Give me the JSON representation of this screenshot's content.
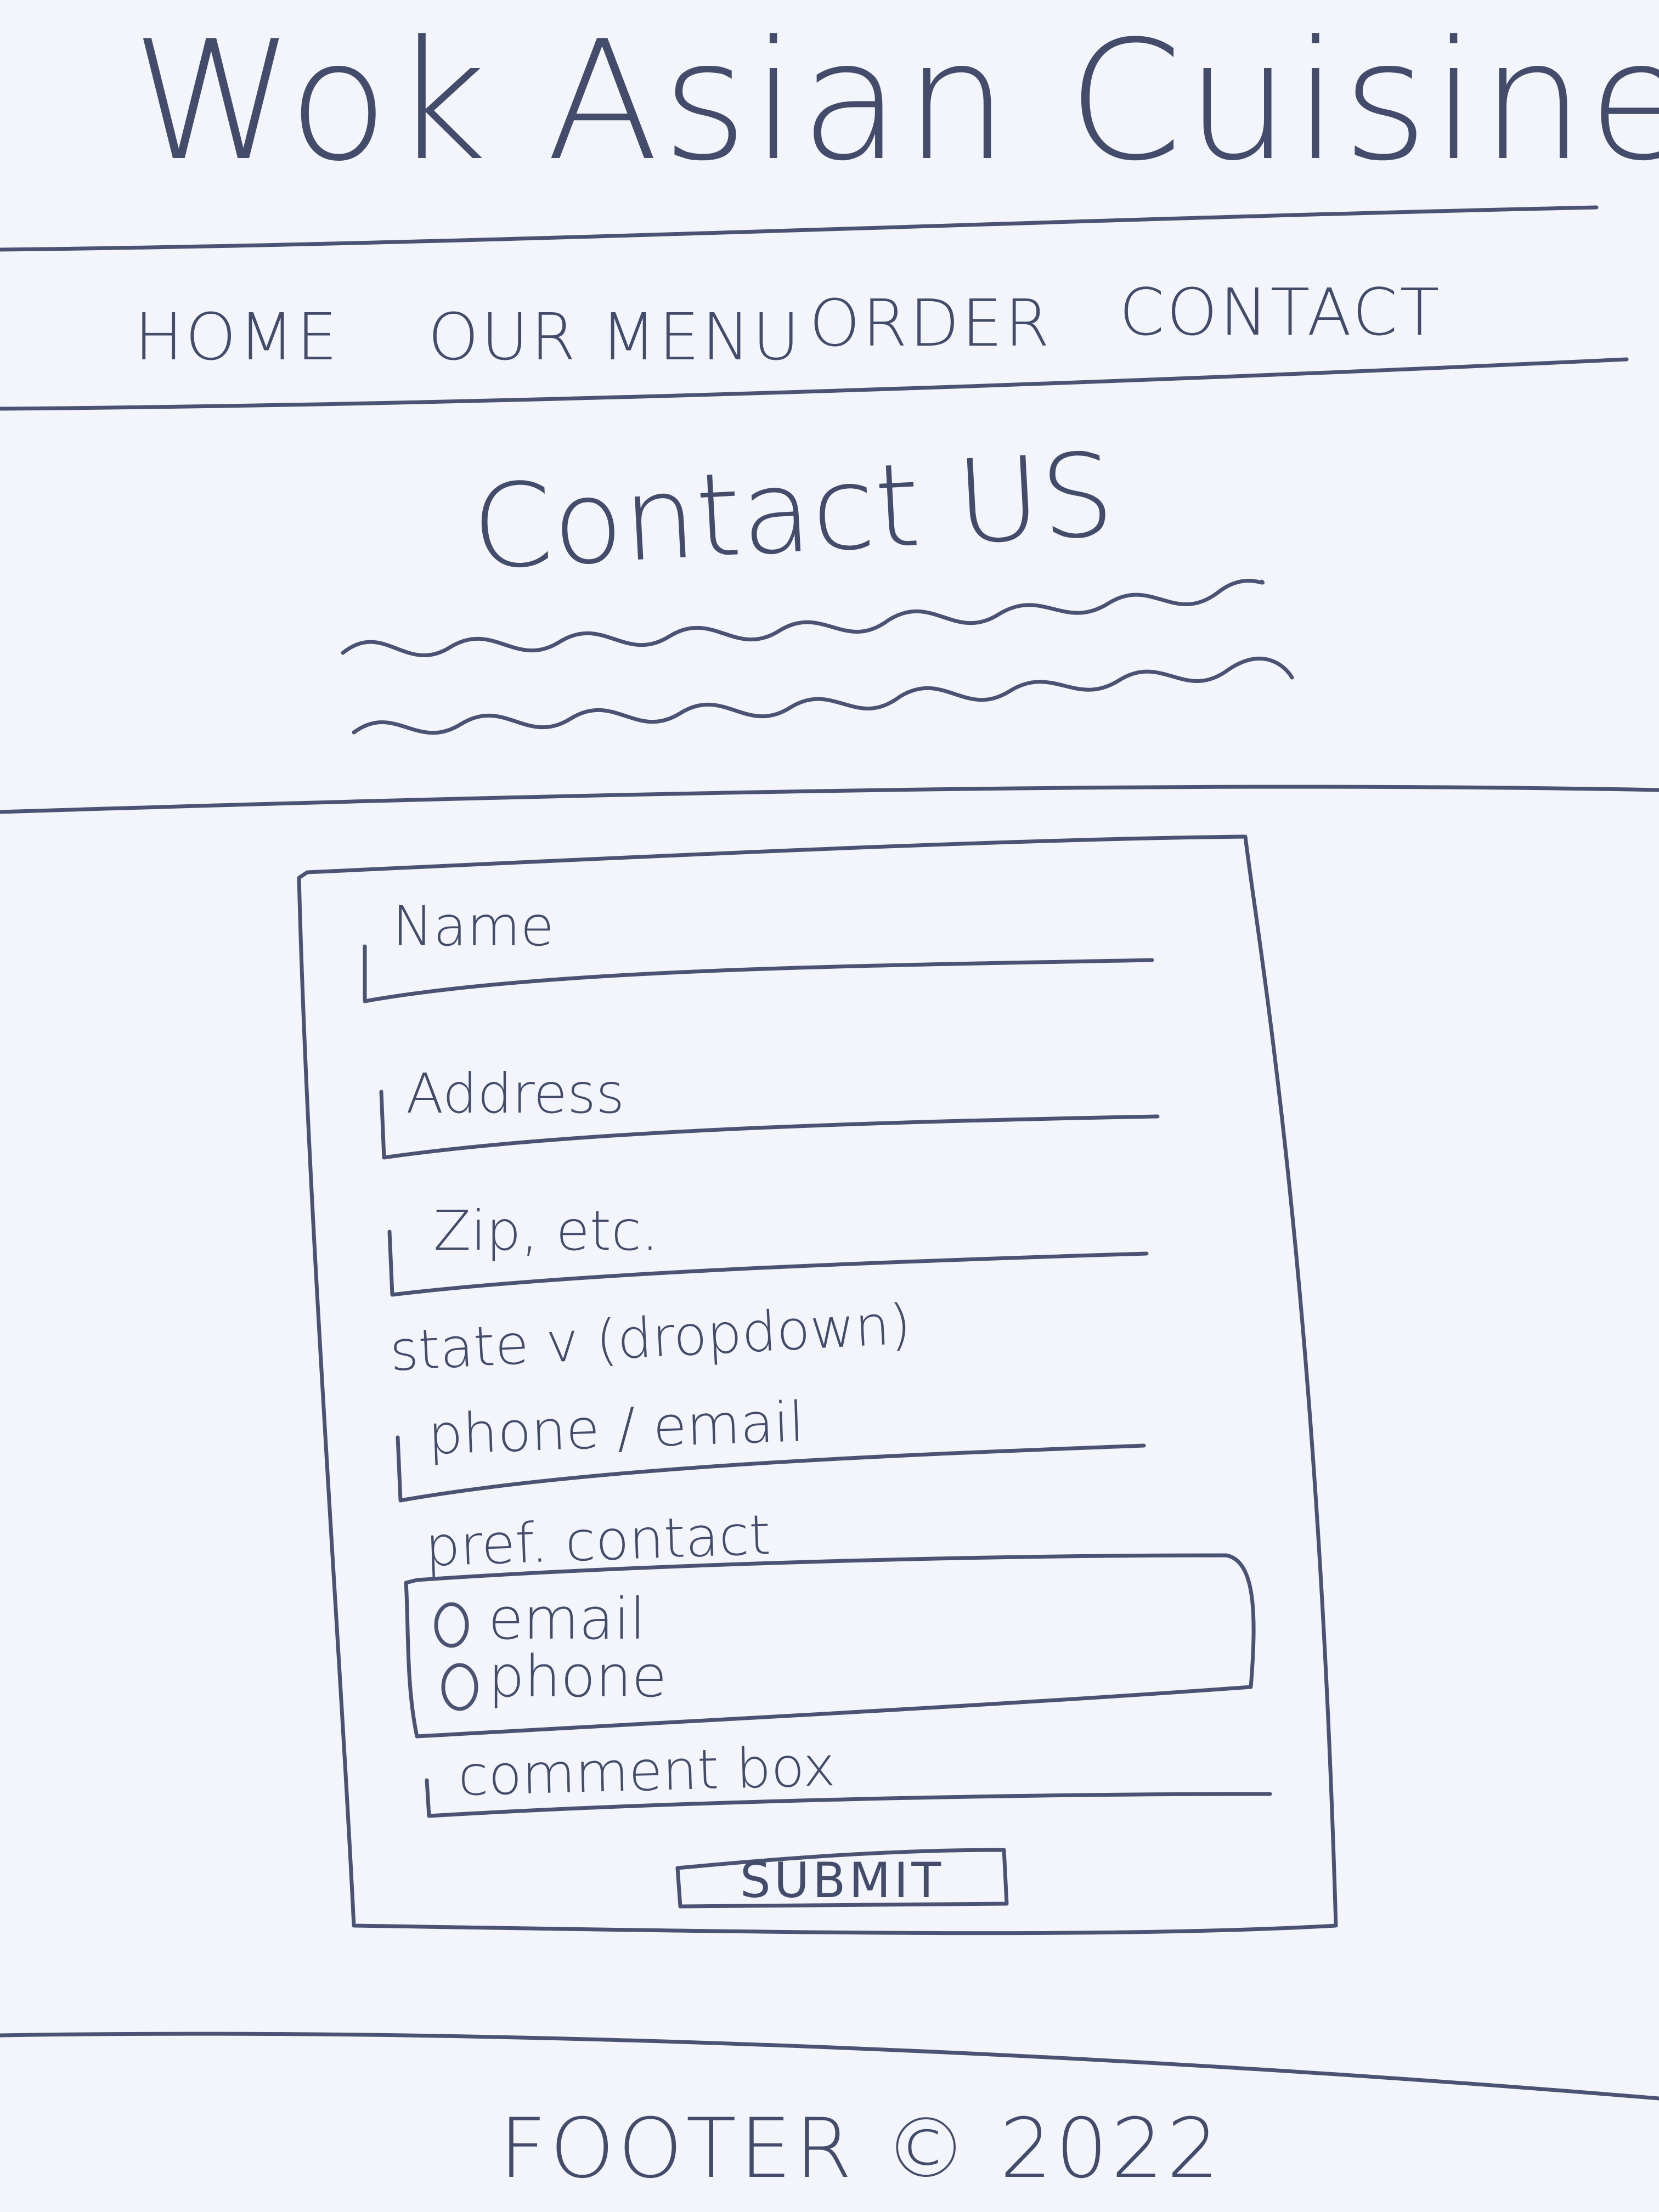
{
  "site": {
    "title": "Wok Asian Cuisine"
  },
  "nav": {
    "items": [
      {
        "label": "HOME"
      },
      {
        "label": "OUR MENU"
      },
      {
        "label": "ORDER"
      },
      {
        "label": "CONTACT"
      }
    ]
  },
  "page": {
    "heading": "Contact US"
  },
  "form": {
    "name_label": "Name",
    "address_label": "Address",
    "zip_label": "Zip, etc.",
    "state_label": "state v (dropdown)",
    "phone_email_label": "phone / email",
    "pref_contact_label": "pref. contact",
    "options": [
      {
        "label": "email"
      },
      {
        "label": "phone"
      }
    ],
    "comment_label": "comment box",
    "submit_label": "SUBMIT"
  },
  "footer": {
    "text": "FOOTER © 2022"
  }
}
